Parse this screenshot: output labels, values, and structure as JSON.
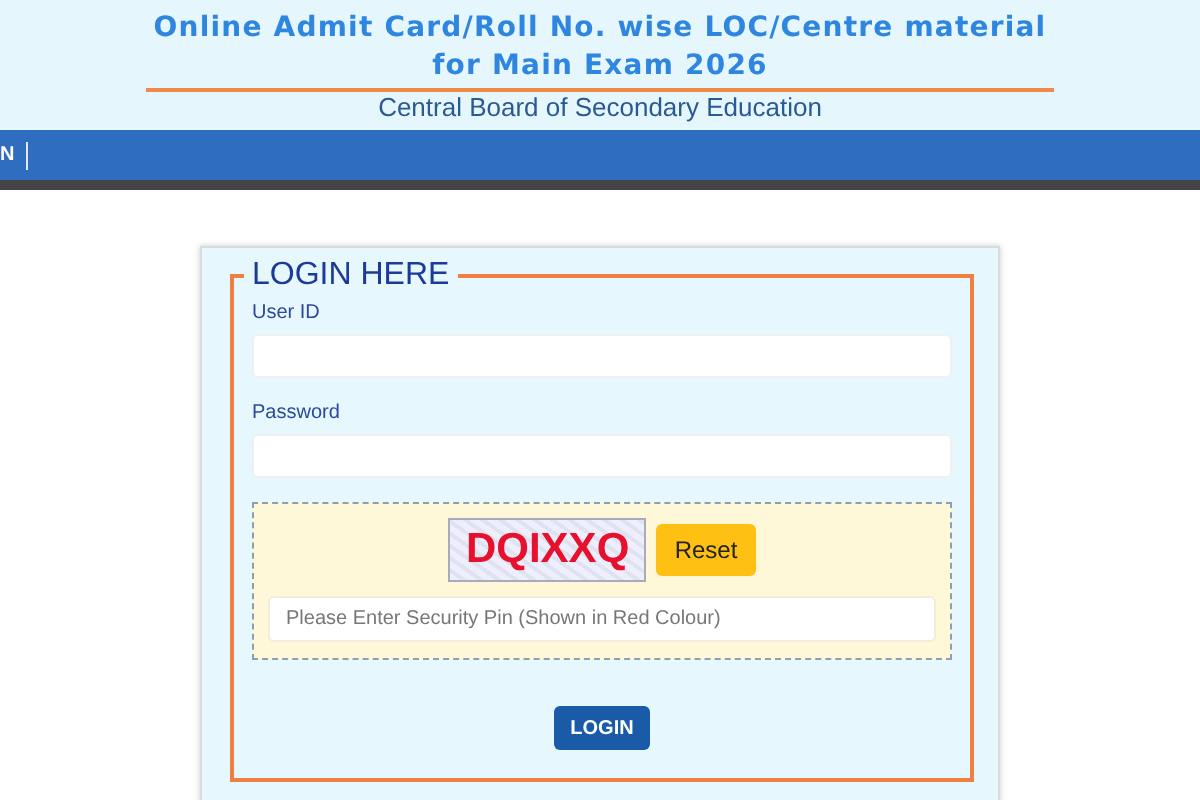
{
  "header": {
    "title_line_1": "Online Admit Card/Roll No. wise LOC/Centre material",
    "title_line_2": "for Main Exam 2026",
    "subtitle": "Central Board of Secondary Education"
  },
  "nav": {
    "items": [
      "N"
    ]
  },
  "login": {
    "legend": "LOGIN HERE",
    "fields": [
      {
        "label": "User ID"
      },
      {
        "label": "Password"
      }
    ],
    "captcha": {
      "code": "DQIXXQ",
      "reset_button": "Reset",
      "placeholder": "Please Enter Security Pin (Shown in Red Colour)"
    },
    "submit_button": "LOGIN"
  }
}
